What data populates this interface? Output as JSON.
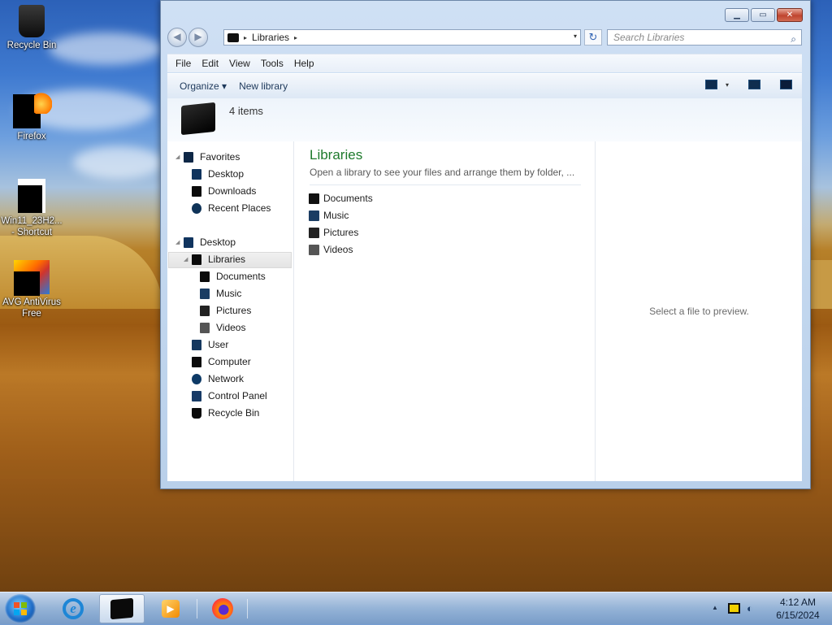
{
  "desktop": {
    "icons": [
      {
        "label": "Recycle Bin",
        "icon": "recycle-bin-icon"
      },
      {
        "label": "Firefox",
        "icon": "firefox-icon"
      },
      {
        "label": "Win11_23H2... - Shortcut",
        "icon": "shortcut-icon"
      },
      {
        "label": "AVG AntiVirus Free",
        "icon": "avg-icon"
      }
    ]
  },
  "window": {
    "controls": {
      "minimize": "▁",
      "maximize": "▭",
      "close": "✕"
    },
    "address": {
      "crumb": "Libraries",
      "chevron": "▸",
      "dropdown": "▾"
    },
    "refresh": "↻",
    "search": {
      "placeholder": "Search Libraries",
      "icon": "🔍"
    },
    "menu": [
      "File",
      "Edit",
      "View",
      "Tools",
      "Help"
    ],
    "toolbar": {
      "organize": "Organize ▾",
      "new_library": "New library",
      "views_dropdown": "▾"
    },
    "header": {
      "count": "4 items"
    },
    "nav": {
      "favorites": "Favorites",
      "fav_items": [
        "Desktop",
        "Downloads",
        "Recent Places"
      ],
      "desktop": "Desktop",
      "libraries": "Libraries",
      "lib_items": [
        "Documents",
        "Music",
        "Pictures",
        "Videos"
      ],
      "others": [
        "User",
        "Computer",
        "Network",
        "Control Panel",
        "Recycle Bin"
      ]
    },
    "content": {
      "title": "Libraries",
      "subtitle": "Open a library to see your files and arrange them by folder, ...",
      "items": [
        "Documents",
        "Music",
        "Pictures",
        "Videos"
      ]
    },
    "preview": {
      "text": "Select a file to preview."
    }
  },
  "taskbar": {
    "clock": {
      "time": "4:12 AM",
      "date": "6/15/2024"
    },
    "tray_arrow": "▲",
    "ie": "e",
    "wmp": "▶"
  }
}
